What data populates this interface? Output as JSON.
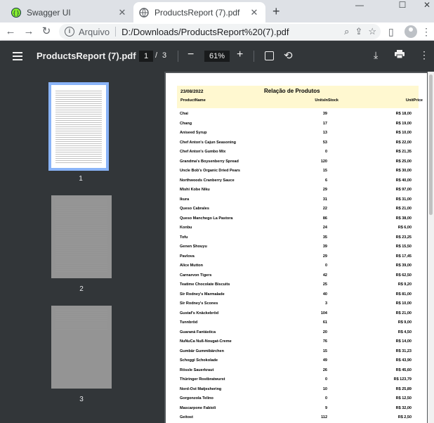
{
  "browser": {
    "tabs": [
      {
        "title": "Swagger UI",
        "active": false
      },
      {
        "title": "ProductsReport (7).pdf",
        "active": true
      }
    ],
    "new_tab_label": "+",
    "address": {
      "scheme_label": "Arquivo",
      "url": "D:/Downloads/ProductsReport%20(7).pdf"
    }
  },
  "viewer": {
    "title": "ProductsReport (7).pdf",
    "current_page": "1",
    "page_separator": "/",
    "total_pages": "3",
    "zoom": "61%",
    "thumbnails": [
      {
        "label": "1"
      },
      {
        "label": "2"
      },
      {
        "label": "3"
      }
    ]
  },
  "report": {
    "date": "23/08/2022",
    "title": "Relação de Produtos",
    "columns": [
      "ProductName",
      "UnitsInStock",
      "UnitPrice"
    ],
    "rows": [
      [
        "Chai",
        "39",
        "R$ 18,00"
      ],
      [
        "Chang",
        "17",
        "R$ 19,00"
      ],
      [
        "Aniseed Syrup",
        "13",
        "R$ 10,00"
      ],
      [
        "Chef Anton's Cajun Seasoning",
        "53",
        "R$ 22,00"
      ],
      [
        "Chef Anton's Gumbo Mix",
        "0",
        "R$ 21,35"
      ],
      [
        "Grandma's Boysenberry Spread",
        "120",
        "R$ 25,00"
      ],
      [
        "Uncle Bob's Organic Dried Pears",
        "15",
        "R$ 30,00"
      ],
      [
        "Northwoods Cranberry Sauce",
        "6",
        "R$ 40,00"
      ],
      [
        "Mishi Kobe Niku",
        "29",
        "R$ 97,00"
      ],
      [
        "Ikura",
        "31",
        "R$ 31,00"
      ],
      [
        "Queso Cabrales",
        "22",
        "R$ 21,00"
      ],
      [
        "Queso Manchego La Pastora",
        "86",
        "R$ 38,00"
      ],
      [
        "Konbu",
        "24",
        "R$ 6,00"
      ],
      [
        "Tofu",
        "35",
        "R$ 23,25"
      ],
      [
        "Genen Shouyu",
        "39",
        "R$ 15,50"
      ],
      [
        "Pavlova",
        "29",
        "R$ 17,45"
      ],
      [
        "Alice Mutton",
        "0",
        "R$ 39,00"
      ],
      [
        "Carnarvon Tigers",
        "42",
        "R$ 62,50"
      ],
      [
        "Teatime Chocolate Biscuits",
        "25",
        "R$ 9,20"
      ],
      [
        "Sir Rodney's Marmalade",
        "40",
        "R$ 81,00"
      ],
      [
        "Sir Rodney's Scones",
        "3",
        "R$ 10,00"
      ],
      [
        "Gustaf's Knäckebröd",
        "104",
        "R$ 21,00"
      ],
      [
        "Tunnbröd",
        "61",
        "R$ 9,00"
      ],
      [
        "Guaraná Fantástica",
        "20",
        "R$ 4,50"
      ],
      [
        "NuNuCa Nuß-Nougat-Creme",
        "76",
        "R$ 14,00"
      ],
      [
        "Gumbär Gummibärchen",
        "15",
        "R$ 31,23"
      ],
      [
        "Schoggi Schokolade",
        "49",
        "R$ 43,90"
      ],
      [
        "Rössle Sauerkraut",
        "26",
        "R$ 45,60"
      ],
      [
        "Thüringer Rostbratwurst",
        "0",
        "R$ 123,79"
      ],
      [
        "Nord-Ost Matjeshering",
        "10",
        "R$ 25,89"
      ],
      [
        "Gorgonzola Telino",
        "0",
        "R$ 12,50"
      ],
      [
        "Mascarpone Fabioli",
        "9",
        "R$ 32,00"
      ],
      [
        "Geitost",
        "112",
        "R$ 2,50"
      ]
    ]
  }
}
